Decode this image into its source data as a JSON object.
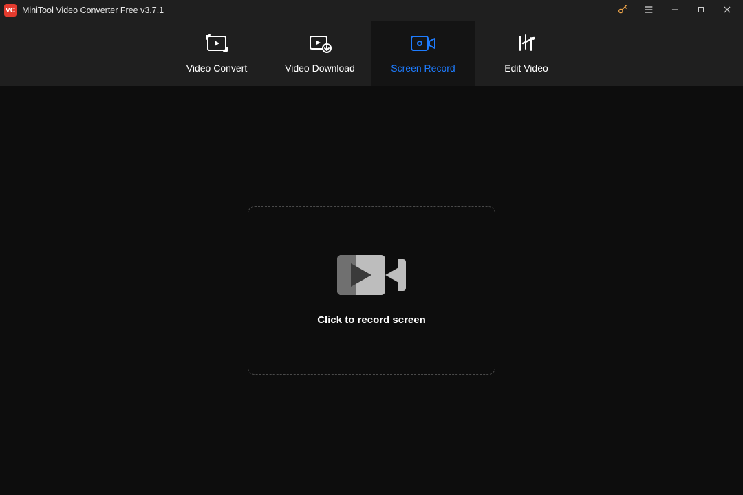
{
  "app": {
    "title": "MiniTool Video Converter Free v3.7.1",
    "logo_text": "VC"
  },
  "nav": {
    "tabs": [
      {
        "label": "Video Convert"
      },
      {
        "label": "Video Download"
      },
      {
        "label": "Screen Record"
      },
      {
        "label": "Edit Video"
      }
    ],
    "active_index": 2
  },
  "main": {
    "record_label": "Click to record screen"
  }
}
